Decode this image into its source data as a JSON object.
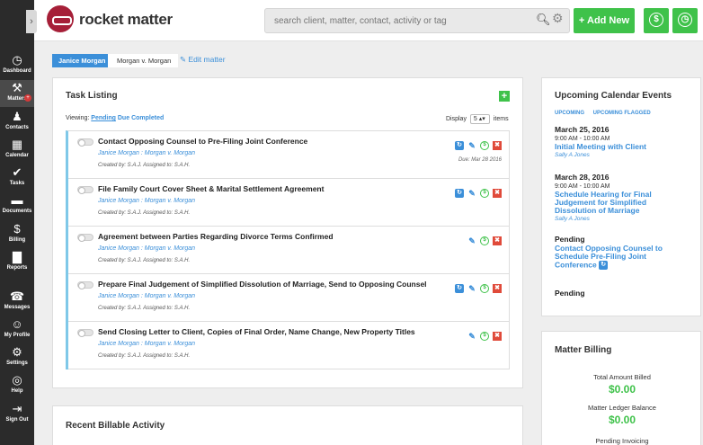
{
  "app": {
    "name": "rocket matter"
  },
  "search": {
    "placeholder": "search client, matter, contact, activity or tag"
  },
  "header": {
    "add_new": "+ Add New",
    "billing_icon": "dollar-icon",
    "timer_icon": "clock-icon"
  },
  "sidebar": {
    "items": [
      {
        "label": "Dashboard",
        "icon": "◷"
      },
      {
        "label": "Matters",
        "icon": "⚒"
      },
      {
        "label": "Contacts",
        "icon": "♟"
      },
      {
        "label": "Calendar",
        "icon": "▦"
      },
      {
        "label": "Tasks",
        "icon": "✔"
      },
      {
        "label": "Documents",
        "icon": "▬"
      },
      {
        "label": "Billing",
        "icon": "$"
      },
      {
        "label": "Reports",
        "icon": "▇"
      },
      {
        "label": "Messages",
        "icon": "☎"
      },
      {
        "label": "My Profile",
        "icon": "☺"
      },
      {
        "label": "Settings",
        "icon": "⚙"
      },
      {
        "label": "Help",
        "icon": "◎"
      },
      {
        "label": "Sign Out",
        "icon": "⇥"
      }
    ],
    "matters_badge": "+"
  },
  "breadcrumb": {
    "client": "Janice Morgan",
    "matter": "Morgan v. Morgan",
    "edit": "Edit matter"
  },
  "tasks": {
    "title": "Task Listing",
    "viewing_label": "Viewing:",
    "filters": [
      "Pending",
      "Due",
      "Completed"
    ],
    "display_label": "Display",
    "display_value": "5",
    "display_suffix": "items",
    "items": [
      {
        "title": "Contact Opposing Counsel to Pre-Filing Joint Conference",
        "matter": "Janice Morgan : Morgan v. Morgan",
        "created": "Created by: S.A.J. Assigned to: S.A.H.",
        "due": "Due: Mar 28 2016"
      },
      {
        "title": "File Family Court Cover Sheet & Marital Settlement Agreement",
        "matter": "Janice Morgan : Morgan v. Morgan",
        "created": "Created by: S.A.J. Assigned to: S.A.H.",
        "due": ""
      },
      {
        "title": "Agreement between Parties Regarding Divorce Terms Confirmed",
        "matter": "Janice Morgan : Morgan v. Morgan",
        "created": "Created by: S.A.J. Assigned to: S.A.H.",
        "due": ""
      },
      {
        "title": "Prepare Final Judgement of Simplified Dissolution of Marriage, Send to Opposing Counsel",
        "matter": "Janice Morgan : Morgan v. Morgan",
        "created": "Created by: S.A.J. Assigned to: S.A.H.",
        "due": ""
      },
      {
        "title": "Send Closing Letter to Client, Copies of Final Order, Name Change, New Property Titles",
        "matter": "Janice Morgan : Morgan v. Morgan",
        "created": "Created by: S.A.J. Assigned to: S.A.H.",
        "due": ""
      }
    ]
  },
  "activity": {
    "title": "Recent Billable Activity"
  },
  "calendar": {
    "title": "Upcoming Calendar Events",
    "tabs": [
      "UPCOMING",
      "UPCOMING FLAGGED"
    ],
    "events": [
      {
        "date": "March 25, 2016",
        "time": "9:00 AM - 10:00 AM",
        "title": "Initial Meeting with Client",
        "who": "Sally A Jones"
      },
      {
        "date": "March 28, 2016",
        "time": "9:00 AM - 10:00 AM",
        "title": "Schedule Hearing for Final Judgement for Simplified Dissolution of Marriage",
        "who": "Sally A Jones"
      },
      {
        "date": "Pending",
        "time": "",
        "title": "Contact Opposing Counsel to Schedule Pre-Filing Joint Conference",
        "who": ""
      },
      {
        "date": "Pending",
        "time": "",
        "title": "",
        "who": ""
      }
    ]
  },
  "billing": {
    "title": "Matter Billing",
    "total_label": "Total Amount Billed",
    "total_value": "$0.00",
    "ledger_label": "Matter Ledger Balance",
    "ledger_value": "$0.00",
    "pending_label": "Pending Invoicing"
  },
  "colors": {
    "accent": "#3b8fd9",
    "green": "#3fc24a",
    "brand": "#a61f38",
    "sidebar": "#2b2b2b"
  }
}
